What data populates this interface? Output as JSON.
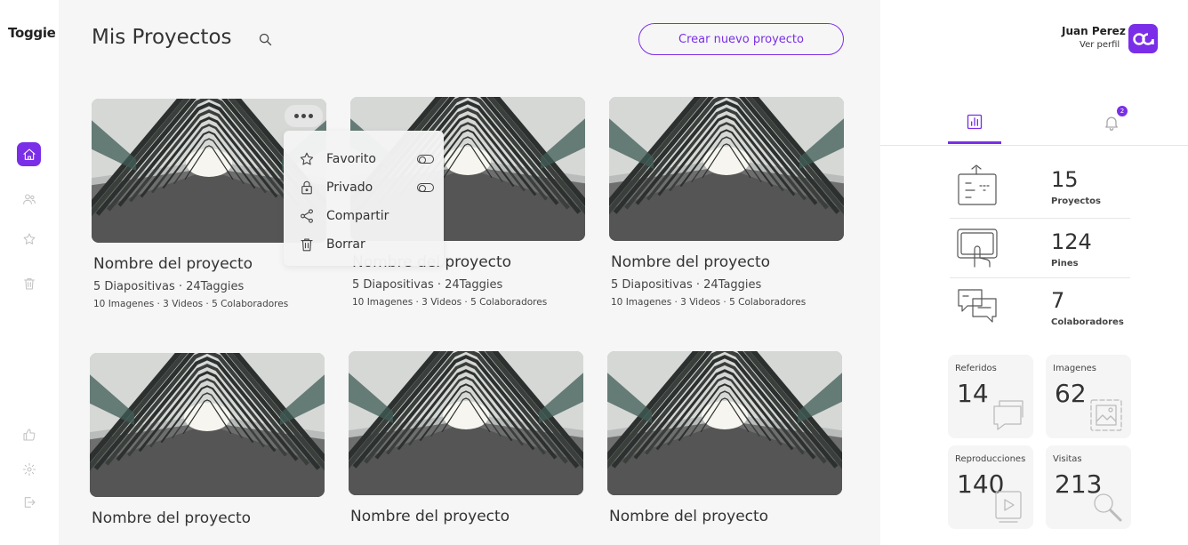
{
  "app": {
    "logo": "Toggie"
  },
  "header": {
    "title": "Mis Proyectos",
    "create_label": "Crear nuevo proyecto"
  },
  "sidebar": {
    "items": [
      {
        "name": "home-icon",
        "active": true
      },
      {
        "name": "users-icon",
        "active": false
      },
      {
        "name": "star-icon",
        "active": false
      },
      {
        "name": "trash-icon",
        "active": false
      },
      {
        "name": "thumbs-up-icon",
        "active": false
      },
      {
        "name": "gear-icon",
        "active": false
      },
      {
        "name": "logout-icon",
        "active": false
      }
    ]
  },
  "projects": [
    {
      "title": "Nombre del proyecto",
      "sub": "5 Diapositivas · 24Taggies",
      "meta": "10 Imagenes · 3 Videos · 5 Colaboradores"
    },
    {
      "title": "Nombre del proyecto",
      "sub": "5 Diapositivas · 24Taggies",
      "meta": "10 Imagenes · 3 Videos · 5 Colaboradores"
    },
    {
      "title": "Nombre del proyecto",
      "sub": "5 Diapositivas · 24Taggies",
      "meta": "10 Imagenes · 3 Videos · 5 Colaboradores"
    },
    {
      "title": "Nombre del proyecto"
    },
    {
      "title": "Nombre del proyecto"
    },
    {
      "title": "Nombre del proyecto"
    }
  ],
  "context_menu": {
    "items": [
      {
        "label": "Favorito",
        "icon": "star-icon",
        "toggle": true
      },
      {
        "label": "Privado",
        "icon": "lock-icon",
        "toggle": true
      },
      {
        "label": "Compartir",
        "icon": "share-icon",
        "toggle": false
      },
      {
        "label": "Borrar",
        "icon": "trash-icon",
        "toggle": false
      }
    ]
  },
  "user": {
    "name": "Juan Perez",
    "link": "Ver perfil"
  },
  "panel": {
    "tabs": [
      {
        "name": "stats-tab",
        "icon": "bar-chart-icon",
        "active": true
      },
      {
        "name": "notifications-tab",
        "icon": "bell-icon",
        "active": false,
        "badge": "2"
      }
    ],
    "stats": [
      {
        "num": "15",
        "label": "Proyectos",
        "icon": "presentation-icon"
      },
      {
        "num": "124",
        "label": "Pines",
        "icon": "touch-screen-icon"
      },
      {
        "num": "7",
        "label": "Colaboradores",
        "icon": "chat-bubbles-icon"
      }
    ],
    "tiles": [
      {
        "label": "Referidos",
        "num": "14",
        "icon": "chat-icon"
      },
      {
        "label": "Imagenes",
        "num": "62",
        "icon": "image-icon"
      },
      {
        "label": "Reproducciones",
        "num": "140",
        "icon": "play-icon"
      },
      {
        "label": "Visitas",
        "num": "213",
        "icon": "search-icon"
      }
    ]
  },
  "colors": {
    "accent": "#7a2ee8",
    "background": "#f6f6f6"
  }
}
